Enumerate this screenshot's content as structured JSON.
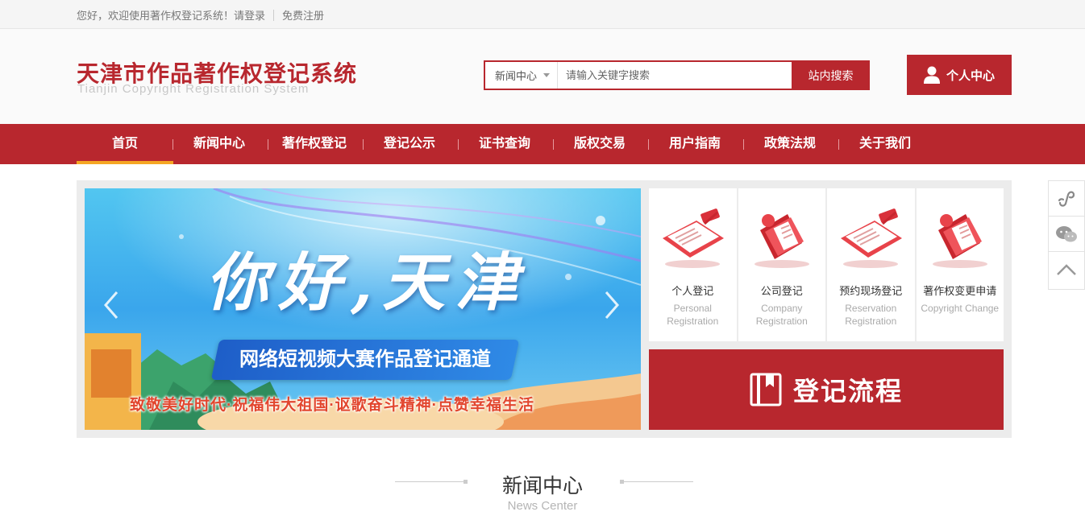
{
  "topbar": {
    "welcome": "您好，欢迎使用著作权登记系统！",
    "login": "请登录",
    "register": "免费注册"
  },
  "header": {
    "logo_cn": "天津市作品著作权登记系统",
    "logo_en": "Tianjin Copyright Registration System",
    "search": {
      "category": "新闻中心",
      "placeholder": "请输入关键字搜索",
      "button": "站内搜索"
    },
    "user_center": "个人中心"
  },
  "nav": {
    "items": [
      {
        "label": "首页",
        "active": true
      },
      {
        "label": "新闻中心"
      },
      {
        "label": "著作权登记"
      },
      {
        "label": "登记公示"
      },
      {
        "label": "证书查询"
      },
      {
        "label": "版权交易"
      },
      {
        "label": "用户指南"
      },
      {
        "label": "政策法规"
      },
      {
        "label": "关于我们"
      }
    ]
  },
  "banner": {
    "title": "你好,天津",
    "pill": "网络短视频大赛作品登记通道",
    "subtitle": "致敬美好时代·祝福伟大祖国·讴歌奋斗精神·点赞幸福生活",
    "prev_icon": "chevron-left-icon",
    "next_icon": "chevron-right-icon"
  },
  "cards": [
    {
      "cn": "个人登记",
      "en": "Personal Registration",
      "icon": "clipboard-icon"
    },
    {
      "cn": "公司登记",
      "en": "Company Registration",
      "icon": "folder-icon"
    },
    {
      "cn": "预约现场登记",
      "en": "Reservation Registration",
      "icon": "clipboard-icon"
    },
    {
      "cn": "著作权变更申请",
      "en": "Copyright Change",
      "icon": "folder-icon"
    }
  ],
  "process": {
    "label": "登记流程",
    "icon": "book-icon"
  },
  "side_tools": [
    "mini-program-icon",
    "wechat-icon",
    "back-to-top-icon"
  ],
  "news": {
    "title": "新闻中心",
    "subtitle": "News Center"
  },
  "colors": {
    "brand_red": "#b8272e",
    "nav_active_underline": "#f5a623"
  }
}
